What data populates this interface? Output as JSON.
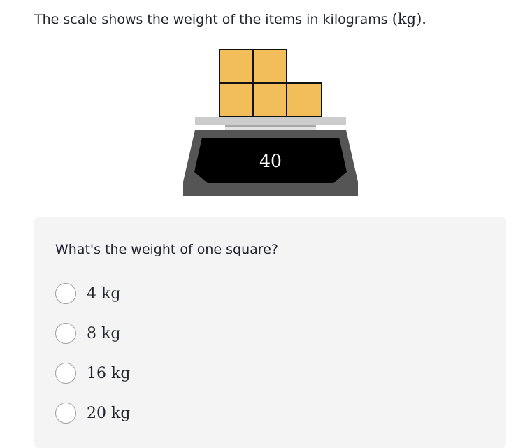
{
  "intro": {
    "text": "The scale shows the weight of the items in kilograms",
    "unit_math": "(kg)",
    "period": "."
  },
  "scale": {
    "reading": "40",
    "square_count": 5,
    "square_color": "#f2be5a",
    "body_color": "#555555",
    "display_color": "#000000",
    "platform_color": "#cccccc"
  },
  "question": {
    "prompt": "What's the weight of one square?",
    "choices": [
      {
        "label": "4 kg"
      },
      {
        "label": "8 kg"
      },
      {
        "label": "16 kg"
      },
      {
        "label": "20 kg"
      }
    ]
  }
}
